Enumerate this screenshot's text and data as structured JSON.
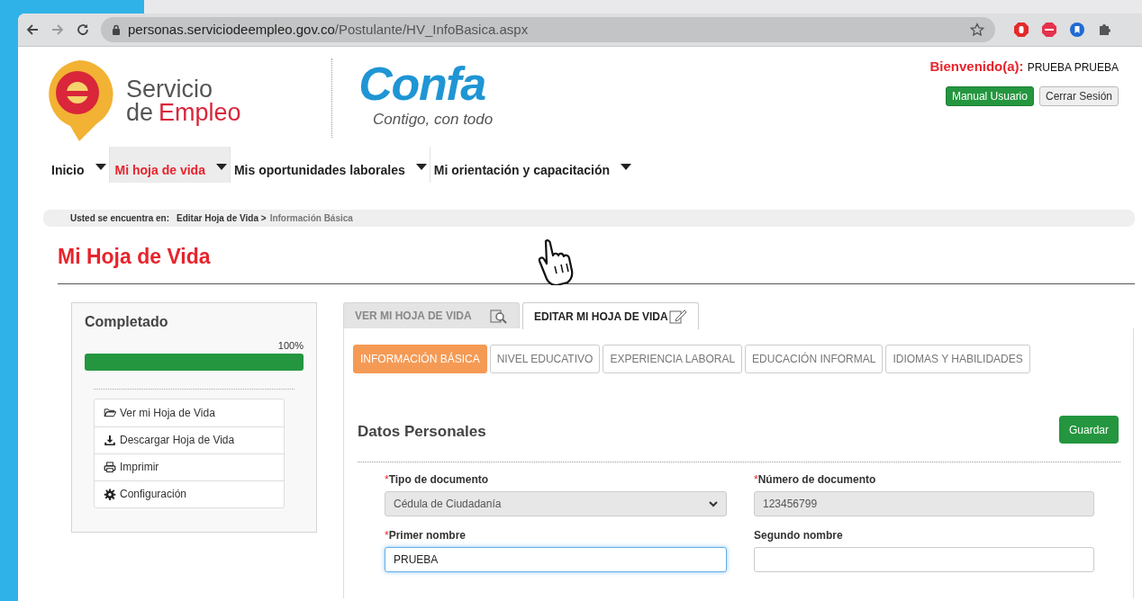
{
  "browser": {
    "url_host": "personas.serviciodeempleo.gov.co",
    "url_path": "/Postulante/HV_InfoBasica.aspx"
  },
  "logos": {
    "servicio": "Servicio",
    "de": "de",
    "empleo": "Empleo",
    "confa": "Confa",
    "confa_tagline": "Contigo, con todo"
  },
  "welcome": {
    "label": "Bienvenido(a):",
    "user": "PRUEBA PRUEBA"
  },
  "header_buttons": [
    {
      "label": "Manual Usuario",
      "kind": "primary"
    },
    {
      "label": "Cerrar Sesión",
      "kind": "secondary"
    }
  ],
  "nav": [
    {
      "label": "Inicio",
      "selected": false
    },
    {
      "label": "Mi hoja de vida",
      "selected": true
    },
    {
      "label": "Mis oportunidades laborales",
      "selected": false
    },
    {
      "label": "Mi orientación y capacitación",
      "selected": false
    }
  ],
  "breadcrumb": {
    "prefix": "Usted se encuentra en:",
    "parent": "Editar Hoja de Vida >",
    "current": "Información Básica"
  },
  "page_title": "Mi Hoja de Vida",
  "sidebar": {
    "title": "Completado",
    "percent": "100%",
    "level": 1,
    "items": [
      {
        "label": "Ver mi Hoja de Vida",
        "kind": "folder"
      },
      {
        "label": "Descargar Hoja de Vida",
        "kind": "download"
      },
      {
        "label": "Imprimir",
        "kind": "print"
      },
      {
        "label": "Configuración",
        "kind": "settings"
      }
    ]
  },
  "main_tabs": [
    {
      "label": "VER MI HOJA DE VIDA",
      "kind": "view",
      "selected": false
    },
    {
      "label": "EDITAR MI HOJA DE VIDA",
      "kind": "edit",
      "selected": true
    }
  ],
  "section_tabs": [
    {
      "label": "INFORMACIÓN BÁSICA",
      "selected": true
    },
    {
      "label": "NIVEL EDUCATIVO",
      "selected": false
    },
    {
      "label": "EXPERIENCIA LABORAL",
      "selected": false
    },
    {
      "label": "EDUCACIÓN INFORMAL",
      "selected": false
    },
    {
      "label": "IDIOMAS Y HABILIDADES",
      "selected": false
    }
  ],
  "section_title": "Datos Personales",
  "required_mark": "*",
  "save_button": "Guardar",
  "fields": [
    {
      "label": "Tipo de documento",
      "required": true,
      "kind": "select",
      "value": "Cédula de Ciudadanía",
      "disabled": true,
      "focused": false
    },
    {
      "label": "Número de documento",
      "required": true,
      "kind": "text",
      "value": "123456799",
      "disabled": true,
      "focused": false
    },
    {
      "label": "Primer nombre",
      "required": true,
      "kind": "text",
      "value": "PRUEBA",
      "disabled": false,
      "focused": true
    },
    {
      "label": "Segundo nombre",
      "required": false,
      "kind": "text",
      "disabled": false,
      "focused": false
    }
  ]
}
